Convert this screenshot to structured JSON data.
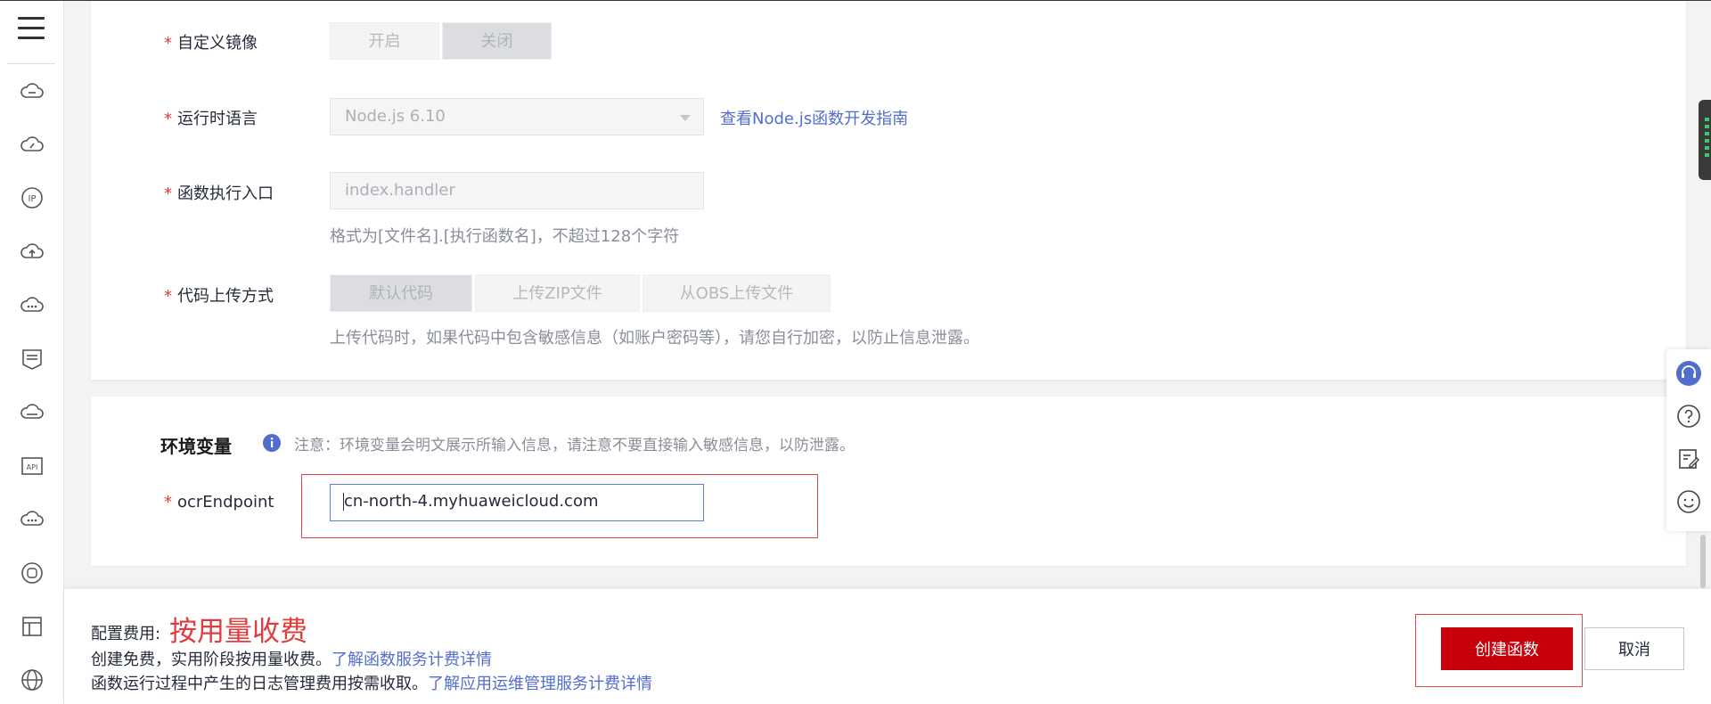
{
  "form": {
    "custom_image": {
      "label": "自定义镜像",
      "options": [
        "开启",
        "关闭"
      ],
      "selected": "关闭"
    },
    "runtime": {
      "label": "运行时语言",
      "value": "Node.js 6.10",
      "guide_link": "查看Node.js函数开发指南"
    },
    "handler": {
      "label": "函数执行入口",
      "placeholder": "index.handler",
      "hint": "格式为[文件名].[执行函数名]，不超过128个字符"
    },
    "upload": {
      "label": "代码上传方式",
      "options": [
        "默认代码",
        "上传ZIP文件",
        "从OBS上传文件"
      ],
      "selected": "默认代码",
      "hint": "上传代码时，如果代码中包含敏感信息（如账户密码等），请您自行加密，以防止信息泄露。"
    }
  },
  "env": {
    "title": "环境变量",
    "note": "注意：环境变量会明文展示所输入信息，请注意不要直接输入敏感信息，以防泄露。",
    "var_name": "ocrEndpoint",
    "var_value": "cn-north-4.myhuaweicloud.com"
  },
  "footer": {
    "fee_label": "配置费用:",
    "fee_mode": "按用量收费",
    "line1_text": "创建免费，实用阶段按用量收费。",
    "line1_link": "了解函数服务计费详情",
    "line2_text": "函数运行过程中产生的日志管理费用按需收取。",
    "line2_link": "了解应用运维管理服务计费详情",
    "create_button": "创建函数",
    "cancel_button": "取消"
  },
  "nav_icons": [
    "menu-icon",
    "cloud-icon",
    "cloud-gauge-icon",
    "ip-icon",
    "cloud-upload-icon",
    "cloud-more-icon",
    "list-shield-icon",
    "cloud-outline-icon",
    "api-icon",
    "cloud-more-icon-2",
    "cylinder-icon",
    "layout-icon",
    "globe-icon"
  ],
  "float_icons": [
    "headset-icon",
    "help-icon",
    "edit-icon",
    "smile-icon"
  ],
  "colors": {
    "primary_red": "#c7000b",
    "required": "#e23b3b",
    "link": "#526ecc",
    "input_focus": "#5e7ce0"
  }
}
